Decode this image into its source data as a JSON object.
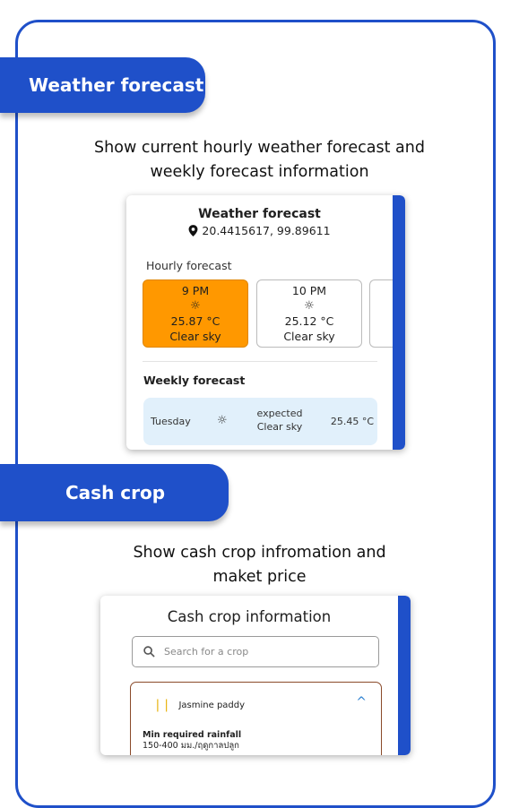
{
  "sections": {
    "weather_tab": "Weather forecast",
    "weather_desc_line1": "Show current hourly weather forecast and",
    "weather_desc_line2": "weekly forecast information",
    "cash_tab": "Cash crop",
    "cash_desc_line1": "Show cash crop infromation and",
    "cash_desc_line2": "maket price"
  },
  "weather_card": {
    "title": "Weather forecast",
    "location": "20.4415617, 99.89611",
    "hourly_label": "Hourly forecast",
    "hourly": [
      {
        "time": "9 PM",
        "icon": "sun-icon",
        "temp": "25.87 °C",
        "cond": "Clear sky"
      },
      {
        "time": "10 PM",
        "icon": "sun-icon",
        "temp": "25.12 °C",
        "cond": "Clear sky"
      }
    ],
    "weekly_label": "Weekly forecast",
    "weekly": [
      {
        "day": "Tuesday",
        "icon": "sun-icon",
        "expected": "expected",
        "cond": "Clear sky",
        "temp": "25.45 °C"
      }
    ],
    "accent_color": "#1f50c9",
    "selected_hour_color": "#ff9800"
  },
  "cash_card": {
    "title": "Cash crop information",
    "search_placeholder": "Search for a crop",
    "crop": {
      "name": "Jasmine paddy",
      "detail_label": "Min required rainfall",
      "detail_value": "150-400 มม./ฤดูกาลปลูก"
    }
  }
}
